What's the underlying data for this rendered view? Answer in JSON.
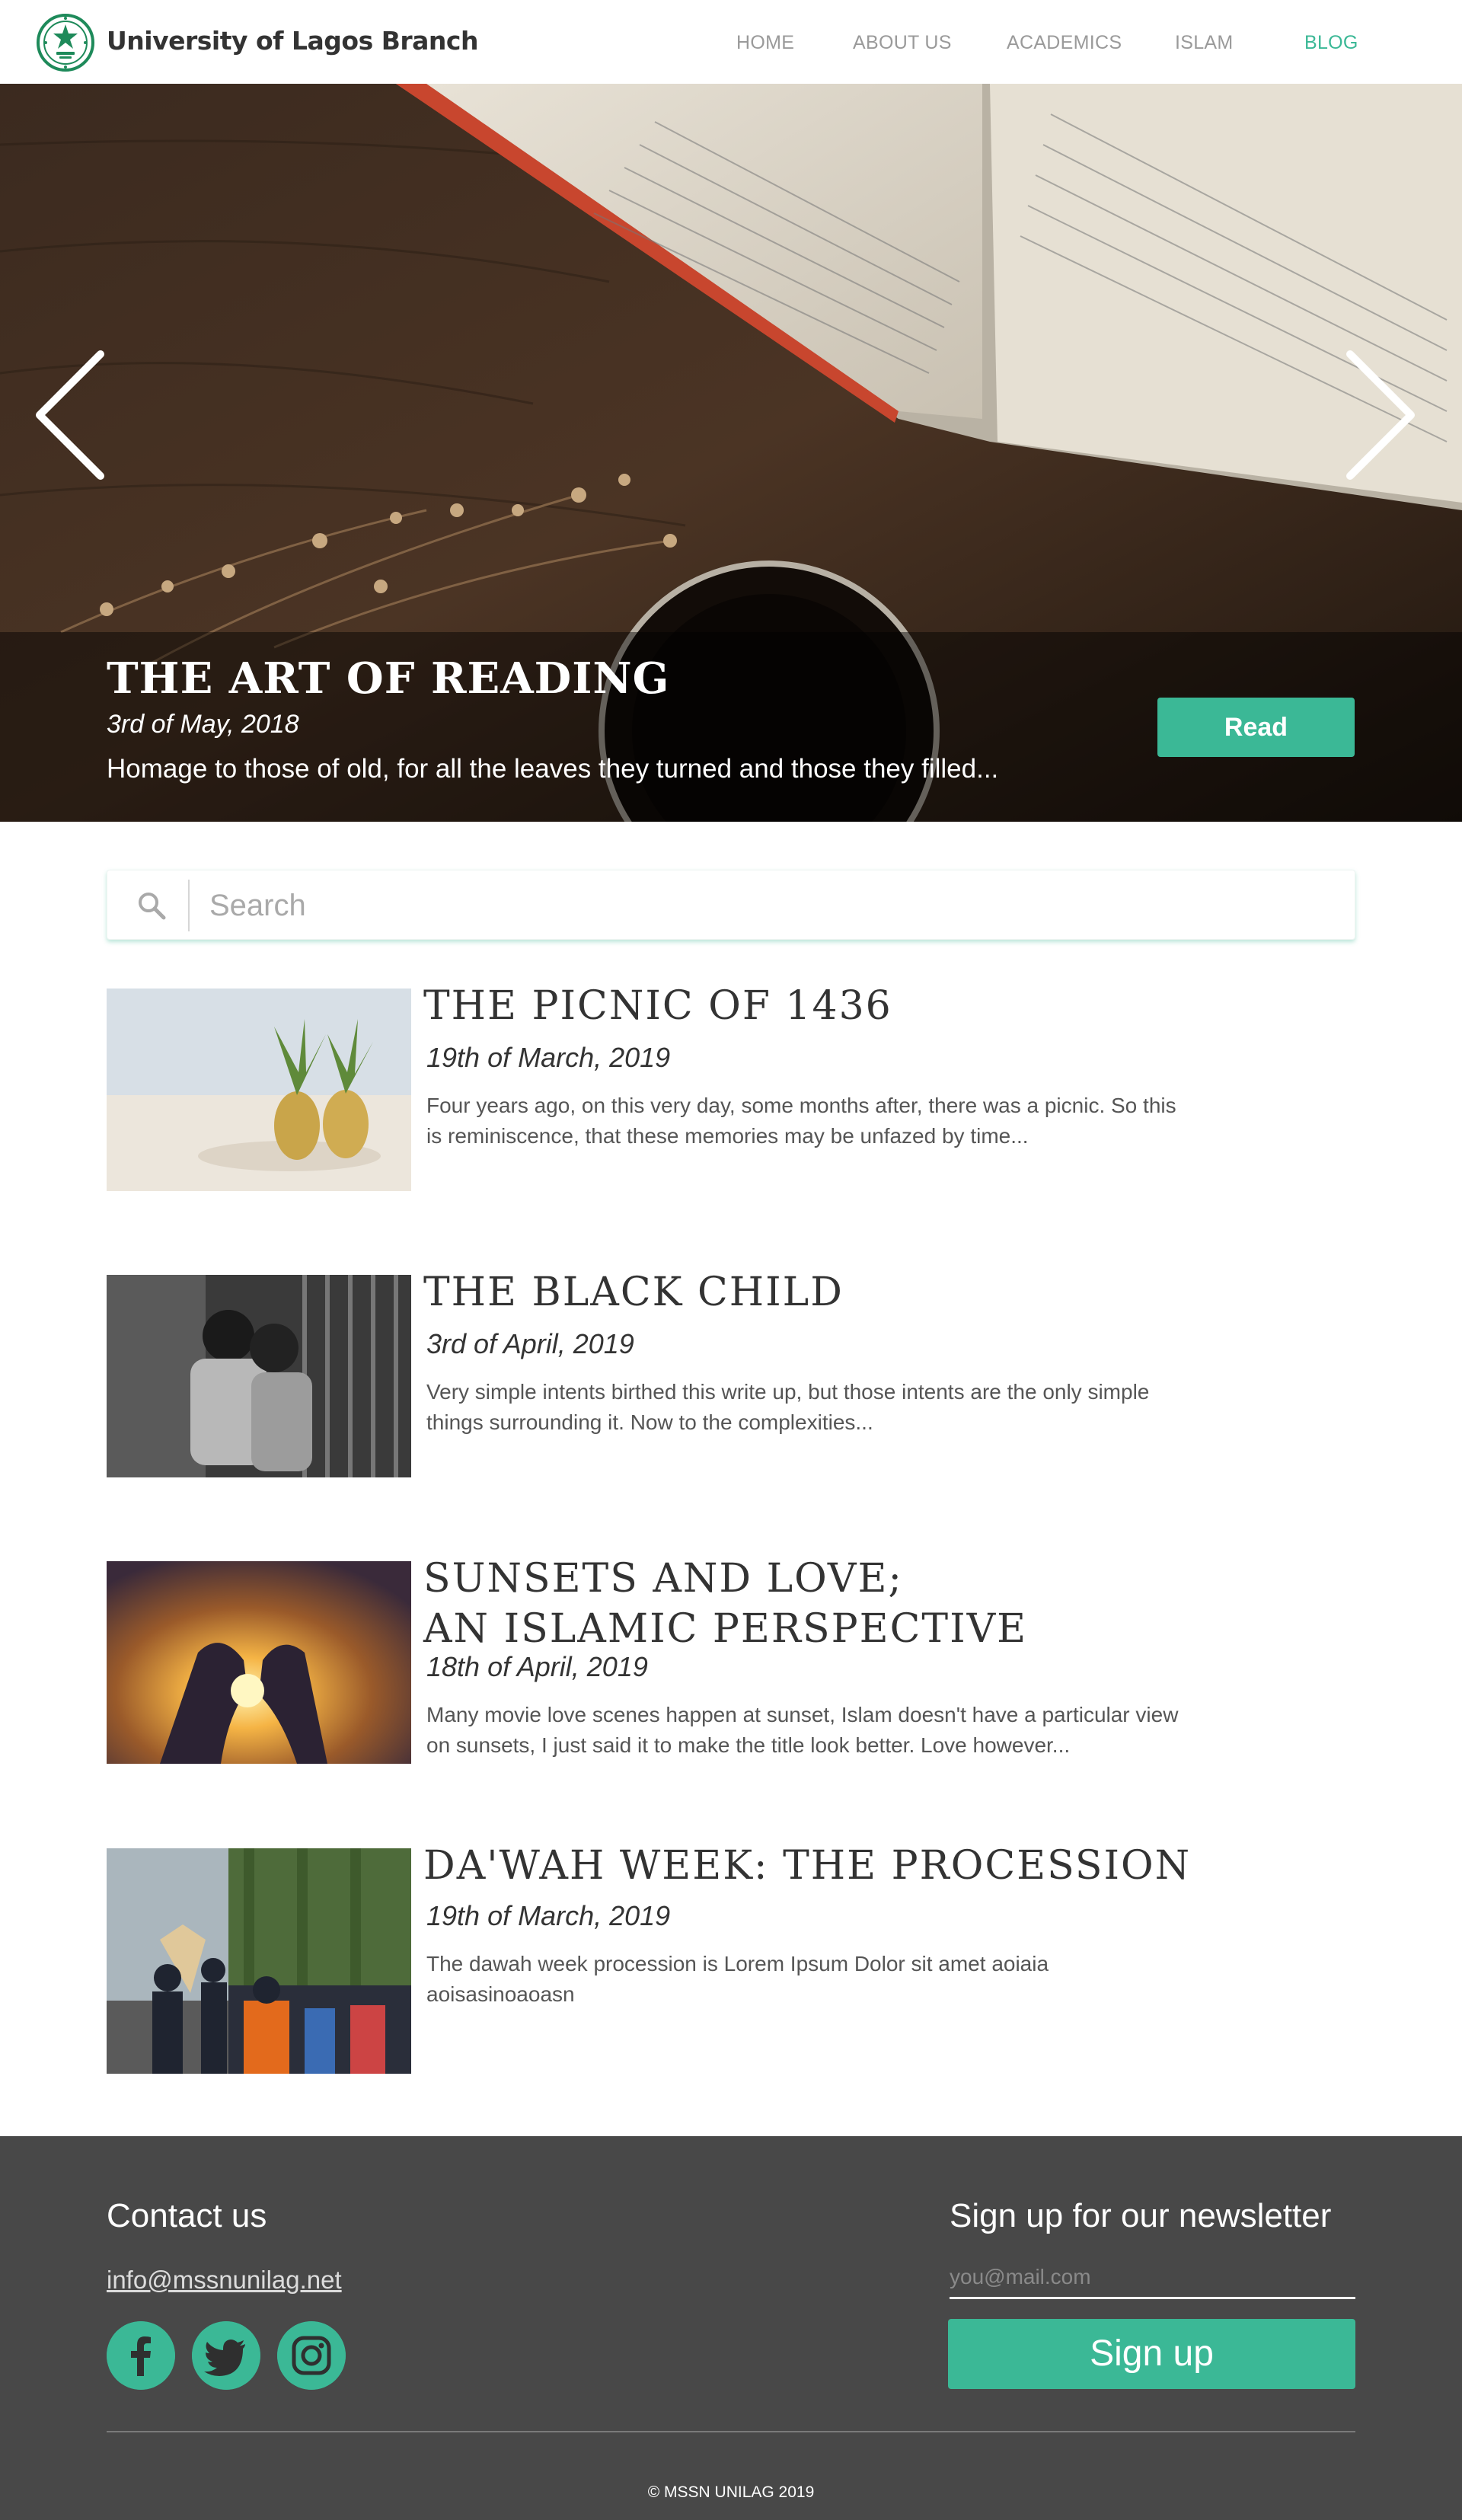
{
  "header": {
    "brand": "University of Lagos Branch",
    "nav": [
      "HOME",
      "ABOUT US",
      "ACADEMICS",
      "ISLAM",
      "BLOG"
    ],
    "active_nav": "BLOG",
    "logo_icon": "mssn-seal-icon"
  },
  "hero": {
    "title": "THE ART OF READING",
    "date": "3rd of May, 2018",
    "excerpt": "Homage to those of old, for all the leaves they turned and those they filled...",
    "read_label": "Read",
    "prev_icon": "chevron-left-icon",
    "next_icon": "chevron-right-icon"
  },
  "search": {
    "placeholder": "Search",
    "icon": "search-icon"
  },
  "posts": [
    {
      "title": "THE PICNIC OF 1436",
      "date": "19th of March, 2019",
      "excerpt_lines": [
        "Four years ago, on this very day, some months after, there was a picnic. So this",
        "is reminiscence, that these memories may be unfazed by time..."
      ],
      "thumb": "pineapples-on-beach"
    },
    {
      "title": "THE BLACK CHILD",
      "date": "3rd of April, 2019",
      "excerpt_lines": [
        "Very simple intents birthed this write up, but those intents are the only simple",
        "things surrounding it. Now to the complexities..."
      ],
      "thumb": "two-children-black-and-white"
    },
    {
      "title_lines": [
        "SUNSETS AND LOVE;",
        "AN ISLAMIC PERSPECTIVE"
      ],
      "date": "18th of April, 2019",
      "excerpt_lines": [
        "Many movie love scenes happen at sunset, Islam doesn't have a particular view",
        "on sunsets, I just said it to make the title look better. Love however..."
      ],
      "thumb": "heart-hands-sunset"
    },
    {
      "title": "DA'WAH WEEK: THE PROCESSION",
      "date": "19th of March, 2019",
      "excerpt_lines": [
        "The dawah week procession is Lorem Ipsum Dolor sit amet aoiaia",
        "aoisasinoaoasn"
      ],
      "thumb": "crowd-procession"
    }
  ],
  "footer": {
    "contact_title": "Contact us",
    "email": "info@mssnunilag.net",
    "social_icons": [
      "facebook-icon",
      "twitter-icon",
      "instagram-icon"
    ],
    "newsletter_title": "Sign up for our newsletter",
    "newsletter_placeholder": "you@mail.com",
    "signup_label": "Sign up",
    "copyright": "© MSSN UNILAG 2019"
  },
  "colors": {
    "accent": "#3bb896",
    "footer_bg": "#484848",
    "nav_inactive": "#9a9a9a"
  }
}
